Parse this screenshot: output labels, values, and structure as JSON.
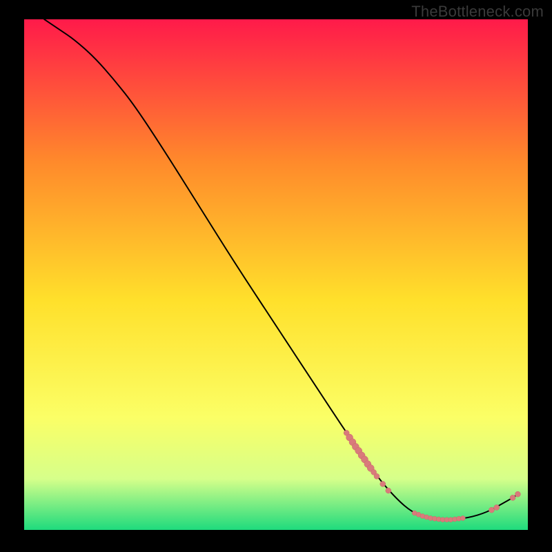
{
  "watermark": "TheBottleneck.com",
  "colors": {
    "bg": "#000000",
    "watermark": "#3a3a3a",
    "curve": "#000000",
    "marker_fill": "#d97b7b",
    "marker_stroke": "#c96a6a",
    "grad_top": "#ff1a4a",
    "grad_mid_upper": "#ff8a2b",
    "grad_mid": "#ffe02b",
    "grad_mid_lower": "#fbff66",
    "grad_lower": "#d6ff8a",
    "grad_bottom": "#1edb7d"
  },
  "chart_data": {
    "type": "line",
    "title": "",
    "xlabel": "",
    "ylabel": "",
    "xlim": [
      0,
      100
    ],
    "ylim": [
      0,
      100
    ],
    "curve": [
      {
        "x": 4,
        "y": 100
      },
      {
        "x": 7,
        "y": 98
      },
      {
        "x": 10,
        "y": 96
      },
      {
        "x": 14,
        "y": 92.5
      },
      {
        "x": 18,
        "y": 88
      },
      {
        "x": 22,
        "y": 83
      },
      {
        "x": 28,
        "y": 74
      },
      {
        "x": 35,
        "y": 63
      },
      {
        "x": 42,
        "y": 52
      },
      {
        "x": 50,
        "y": 40
      },
      {
        "x": 58,
        "y": 28
      },
      {
        "x": 64,
        "y": 19
      },
      {
        "x": 70,
        "y": 10.5
      },
      {
        "x": 74,
        "y": 6
      },
      {
        "x": 77,
        "y": 3.5
      },
      {
        "x": 80,
        "y": 2.3
      },
      {
        "x": 84,
        "y": 2.0
      },
      {
        "x": 88,
        "y": 2.3
      },
      {
        "x": 92,
        "y": 3.5
      },
      {
        "x": 95,
        "y": 5.2
      },
      {
        "x": 97,
        "y": 6.3
      },
      {
        "x": 98,
        "y": 7.0
      }
    ],
    "markers_left_cluster": [
      {
        "x": 64.0,
        "y": 19.0,
        "r": 4
      },
      {
        "x": 64.6,
        "y": 18.1,
        "r": 5
      },
      {
        "x": 65.2,
        "y": 17.2,
        "r": 5
      },
      {
        "x": 65.8,
        "y": 16.3,
        "r": 5
      },
      {
        "x": 66.4,
        "y": 15.5,
        "r": 5
      },
      {
        "x": 67.0,
        "y": 14.6,
        "r": 5
      },
      {
        "x": 67.6,
        "y": 13.8,
        "r": 5
      },
      {
        "x": 68.2,
        "y": 12.9,
        "r": 5
      },
      {
        "x": 68.8,
        "y": 12.1,
        "r": 5
      },
      {
        "x": 69.4,
        "y": 11.3,
        "r": 4
      },
      {
        "x": 70.0,
        "y": 10.5,
        "r": 4
      },
      {
        "x": 71.2,
        "y": 9.0,
        "r": 4
      },
      {
        "x": 72.3,
        "y": 7.7,
        "r": 4
      }
    ],
    "markers_bottom_cluster": [
      {
        "x": 77.5,
        "y": 3.3,
        "r": 3.5
      },
      {
        "x": 78.3,
        "y": 3.0,
        "r": 3.5
      },
      {
        "x": 79.1,
        "y": 2.7,
        "r": 3.5
      },
      {
        "x": 79.9,
        "y": 2.5,
        "r": 3.5
      },
      {
        "x": 80.7,
        "y": 2.3,
        "r": 3.5
      },
      {
        "x": 81.5,
        "y": 2.2,
        "r": 3.5
      },
      {
        "x": 82.3,
        "y": 2.1,
        "r": 3.5
      },
      {
        "x": 83.1,
        "y": 2.0,
        "r": 3.5
      },
      {
        "x": 83.9,
        "y": 2.0,
        "r": 3.5
      },
      {
        "x": 84.7,
        "y": 2.0,
        "r": 3.5
      },
      {
        "x": 85.5,
        "y": 2.1,
        "r": 3.5
      },
      {
        "x": 86.3,
        "y": 2.2,
        "r": 3.5
      },
      {
        "x": 87.1,
        "y": 2.3,
        "r": 3.5
      }
    ],
    "markers_right_cluster": [
      {
        "x": 92.8,
        "y": 3.9,
        "r": 4
      },
      {
        "x": 93.8,
        "y": 4.4,
        "r": 4
      },
      {
        "x": 97.0,
        "y": 6.3,
        "r": 4
      },
      {
        "x": 98.0,
        "y": 7.0,
        "r": 4
      }
    ]
  }
}
